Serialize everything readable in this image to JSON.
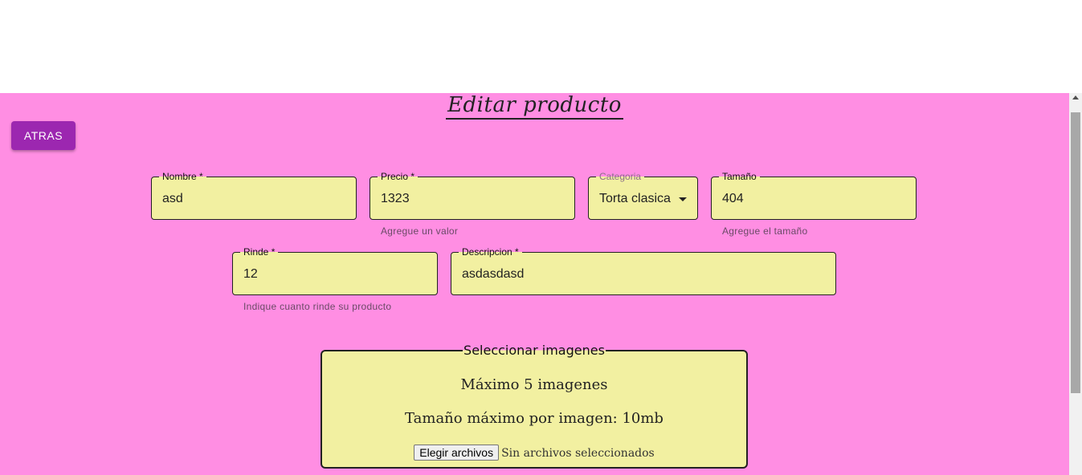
{
  "page_title": "Editar producto",
  "back_button": "ATRAS",
  "fields": {
    "nombre": {
      "label": "Nombre *",
      "value": "asd"
    },
    "precio": {
      "label": "Precio *",
      "value": "1323",
      "helper": "Agregue un valor"
    },
    "categoria": {
      "label": "Categoria",
      "value": "Torta clasica"
    },
    "tamano": {
      "label": "Tamaño",
      "value": "404",
      "helper": "Agregue el tamaño"
    },
    "rinde": {
      "label": "Rinde *",
      "value": "12",
      "helper": "Indique cuanto rinde su producto"
    },
    "descripcion": {
      "label": "Descripcion *",
      "value": "asdasdasd"
    }
  },
  "images": {
    "legend": "Seleccionar imagenes",
    "max_count": "Máximo 5 imagenes",
    "max_size": "Tamaño máximo por imagen: 10mb",
    "choose_button": "Elegir archivos",
    "status": "Sin archivos seleccionados"
  },
  "colors": {
    "background": "#ff8ee3",
    "field_fill": "#f2f0a1",
    "button": "#9c27b0"
  }
}
